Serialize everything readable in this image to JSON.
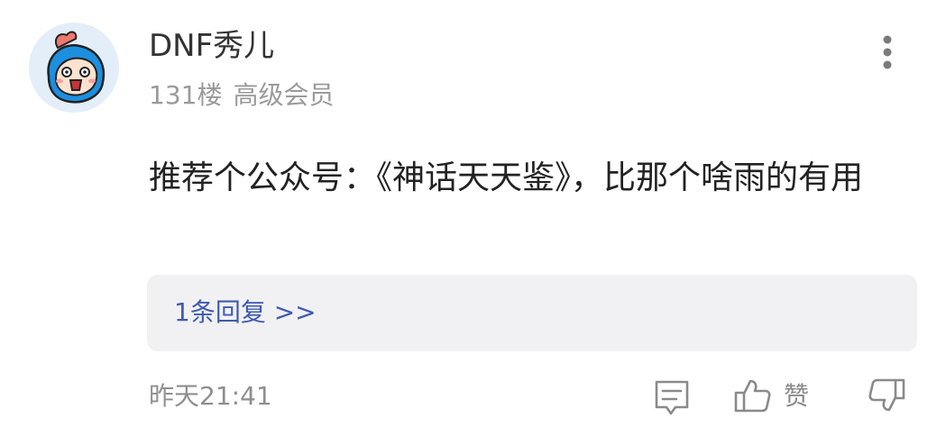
{
  "post": {
    "username": "DNF秀儿",
    "floor": "131楼",
    "member_level": "高级会员",
    "content": "推荐个公众号：《神话天天鉴》，比那个啥雨的有用",
    "replies_link": "1条回复 >>",
    "time": "昨天21:41"
  },
  "actions": {
    "like_label": "赞"
  },
  "icons": {
    "more": "more-vertical-icon",
    "reply": "comment-icon",
    "like": "thumbs-up-icon",
    "dislike": "thumbs-down-icon"
  },
  "colors": {
    "link": "#3f5bb0",
    "secondary_text": "#9a9a9a",
    "avatar_bg": "#e3eef9",
    "avatar_face": "#1d8fe0"
  }
}
